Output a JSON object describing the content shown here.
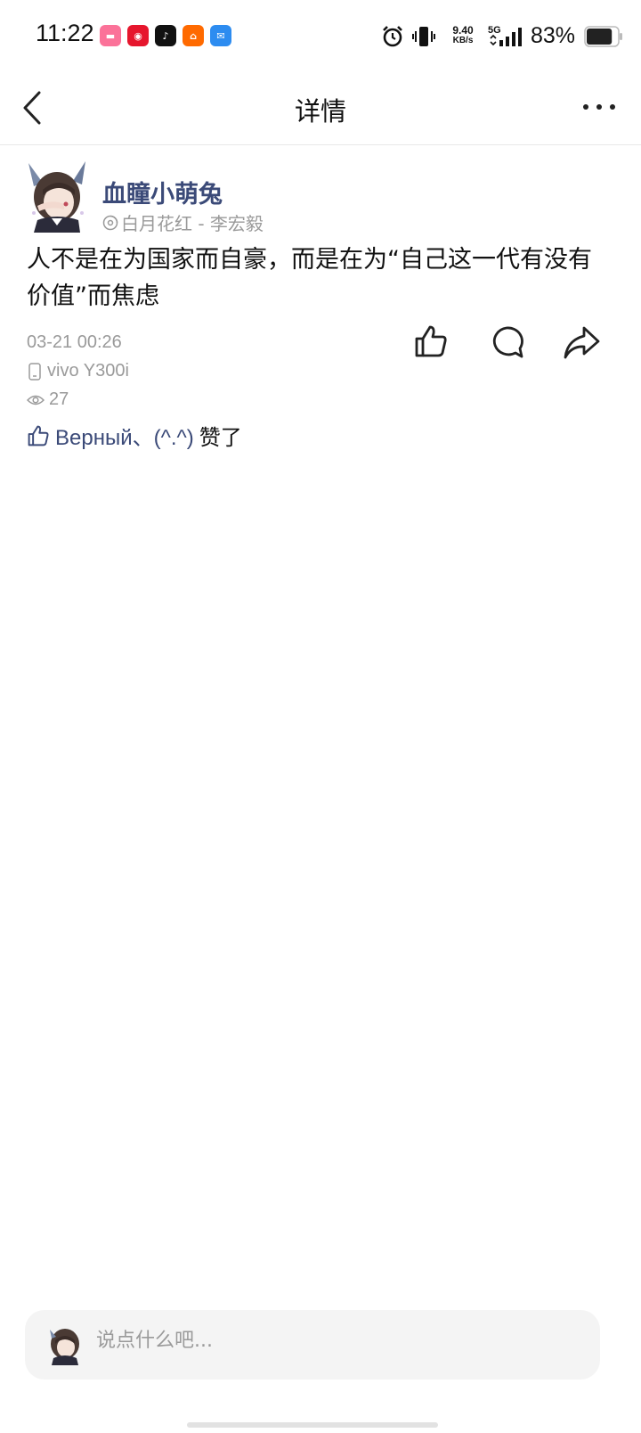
{
  "status_bar": {
    "time": "11:22",
    "app_icons": [
      {
        "name": "bilibili-icon",
        "color": "#fb7299",
        "glyph": "▬"
      },
      {
        "name": "weibo-icon",
        "color": "#e6162d",
        "glyph": "◉"
      },
      {
        "name": "tiktok-icon",
        "color": "#111111",
        "glyph": "♪"
      },
      {
        "name": "taobao-icon",
        "color": "#ff6a00",
        "glyph": "⌂"
      },
      {
        "name": "message-app-icon",
        "color": "#2d8cf0",
        "glyph": "✉"
      }
    ],
    "net_speed_value": "9.40",
    "net_speed_unit": "KB/s",
    "network_type": "5G",
    "battery_percent": "83%",
    "battery_level": 0.83
  },
  "nav": {
    "title": "详情"
  },
  "post": {
    "author_name": "血瞳小萌兔",
    "music": "白月花红 - 李宏毅",
    "text": "人不是在为国家而自豪，而是在为“自己这一代有没有价值”而焦虑",
    "time": "03-21 00:26",
    "device": "vivo Y300i",
    "views": "27",
    "likes_names": "Верный、(^.^)",
    "likes_suffix": "赞了"
  },
  "comment_bar": {
    "placeholder": "说点什么吧..."
  },
  "colors": {
    "accent_name": "#3b4a78",
    "meta_gray": "#9a9a9a"
  }
}
